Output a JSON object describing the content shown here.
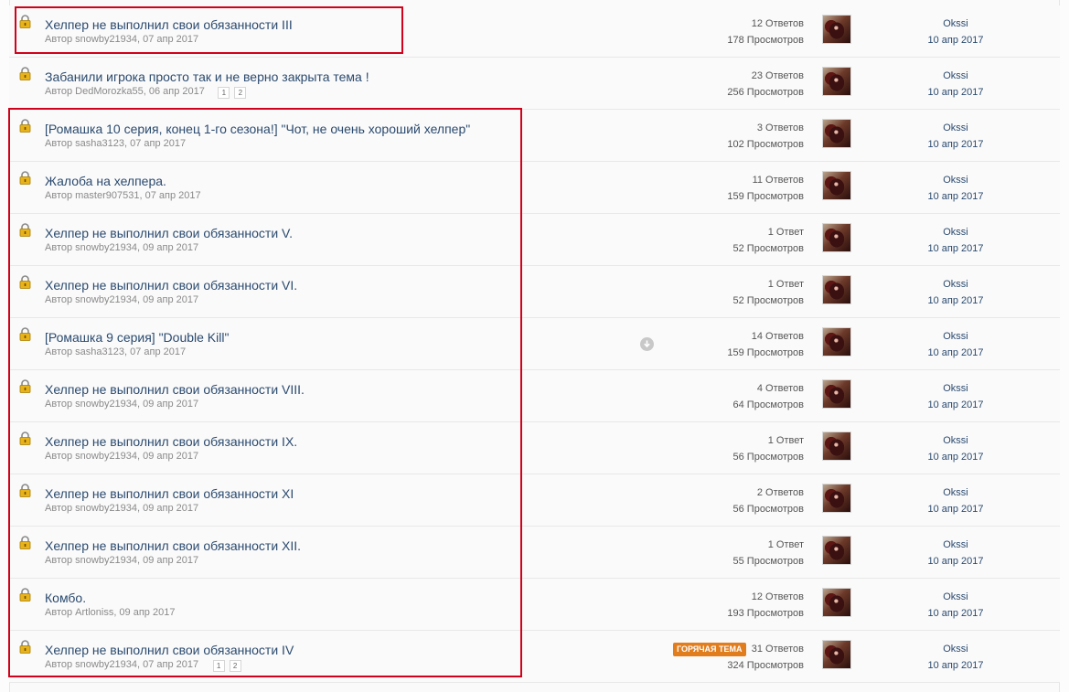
{
  "topics": [
    {
      "title": "Хелпер не выполнил свои обязанности III",
      "author_line": "Автор snowby21934, 07 апр 2017",
      "replies": "12 Ответов",
      "views": "178 Просмотров",
      "last_user": "Okssi",
      "last_date": "10 апр 2017",
      "pages": []
    },
    {
      "title": "Забанили игрока просто так и не верно закрыта тема !",
      "author_line": "Автор DedMorozka55, 06 апр 2017",
      "replies": "23 Ответов",
      "views": "256 Просмотров",
      "last_user": "Okssi",
      "last_date": "10 апр 2017",
      "pages": [
        "1",
        "2"
      ]
    },
    {
      "title": "[Ромашка 10 серия, конец 1-го сезона!] \"Чот, не очень хороший хелпер\"",
      "author_line": "Автор sasha3123, 07 апр 2017",
      "replies": "3 Ответов",
      "views": "102 Просмотров",
      "last_user": "Okssi",
      "last_date": "10 апр 2017",
      "pages": []
    },
    {
      "title": "Жалоба на хелпера.",
      "author_line": "Автор master907531, 07 апр 2017",
      "replies": "11 Ответов",
      "views": "159 Просмотров",
      "last_user": "Okssi",
      "last_date": "10 апр 2017",
      "pages": []
    },
    {
      "title": "Хелпер не выполнил свои обязанности V.",
      "author_line": "Автор snowby21934, 09 апр 2017",
      "replies": "1 Ответ",
      "views": "52 Просмотров",
      "last_user": "Okssi",
      "last_date": "10 апр 2017",
      "pages": []
    },
    {
      "title": "Хелпер не выполнил свои обязанности VI.",
      "author_line": "Автор snowby21934, 09 апр 2017",
      "replies": "1 Ответ",
      "views": "52 Просмотров",
      "last_user": "Okssi",
      "last_date": "10 апр 2017",
      "pages": []
    },
    {
      "title": "[Ромашка 9 серия] \"Double Kill\"",
      "author_line": "Автор sasha3123, 07 апр 2017",
      "replies": "14 Ответов",
      "views": "159 Просмотров",
      "last_user": "Okssi",
      "last_date": "10 апр 2017",
      "pages": [],
      "download_icon": true
    },
    {
      "title": "Хелпер не выполнил свои обязанности VIII.",
      "author_line": "Автор snowby21934, 09 апр 2017",
      "replies": "4 Ответов",
      "views": "64 Просмотров",
      "last_user": "Okssi",
      "last_date": "10 апр 2017",
      "pages": []
    },
    {
      "title": "Хелпер не выполнил свои обязанности IX.",
      "author_line": "Автор snowby21934, 09 апр 2017",
      "replies": "1 Ответ",
      "views": "56 Просмотров",
      "last_user": "Okssi",
      "last_date": "10 апр 2017",
      "pages": []
    },
    {
      "title": "Хелпер не выполнил свои обязанности XI",
      "author_line": "Автор snowby21934, 09 апр 2017",
      "replies": "2 Ответов",
      "views": "56 Просмотров",
      "last_user": "Okssi",
      "last_date": "10 апр 2017",
      "pages": []
    },
    {
      "title": "Хелпер не выполнил свои обязанности XII.",
      "author_line": "Автор snowby21934, 09 апр 2017",
      "replies": "1 Ответ",
      "views": "55 Просмотров",
      "last_user": "Okssi",
      "last_date": "10 апр 2017",
      "pages": []
    },
    {
      "title": "Комбо.",
      "author_line": "Автор Artloniss, 09 апр 2017",
      "replies": "12 Ответов",
      "views": "193 Просмотров",
      "last_user": "Okssi",
      "last_date": "10 апр 2017",
      "pages": []
    },
    {
      "title": "Хелпер не выполнил свои обязанности IV",
      "author_line": "Автор snowby21934, 07 апр 2017",
      "replies": "31 Ответов",
      "views": "324 Просмотров",
      "last_user": "Okssi",
      "last_date": "10 апр 2017",
      "pages": [
        "1",
        "2"
      ],
      "badge": "ГОРЯЧАЯ ТЕМА"
    }
  ],
  "colors": {
    "title_link": "#2b4a6f",
    "meta_text": "#8a8a8a",
    "hot_badge": "#e27d1e",
    "highlight_box": "#d0021b",
    "lock_icon": "#e0a800"
  },
  "icons": {
    "lock": "lock-icon",
    "download": "download-circle-icon"
  }
}
